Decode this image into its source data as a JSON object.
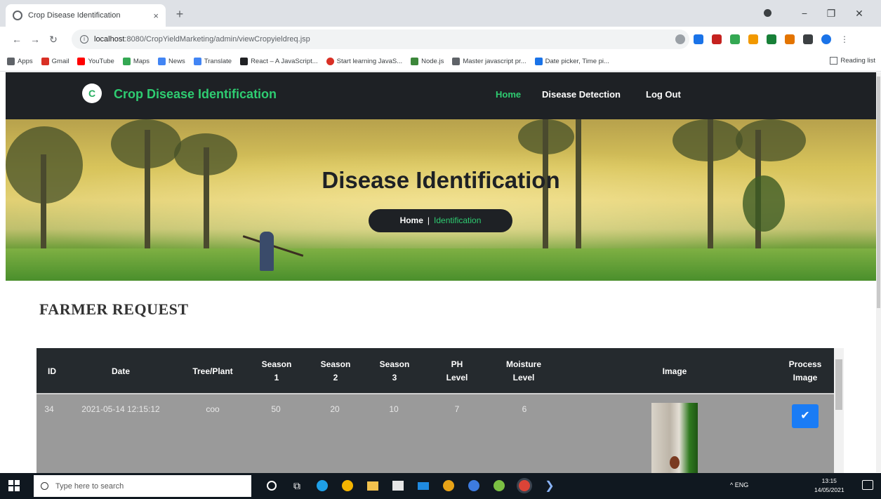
{
  "browser": {
    "tab_title": "Crop Disease Identification",
    "tab_close": "×",
    "new_tab": "+",
    "url_host": "localhost",
    "url_rest": ":8080/CropYieldMarketing/admin/viewCropyieldreq.jsp",
    "win_min": "−",
    "win_max": "❐",
    "win_close": "✕",
    "bookmarks": [
      {
        "label": "Apps",
        "color": "#5f6368"
      },
      {
        "label": "Gmail",
        "color": "#d93025"
      },
      {
        "label": "YouTube",
        "color": "#ff0000"
      },
      {
        "label": "Maps",
        "color": "#34a853"
      },
      {
        "label": "News",
        "color": "#4285f4"
      },
      {
        "label": "Translate",
        "color": "#4285f4"
      },
      {
        "label": "React – A JavaScript...",
        "color": "#202124"
      },
      {
        "label": "Start learning JavaS...",
        "color": "#d93025"
      },
      {
        "label": "Node.js",
        "color": "#3c873a"
      },
      {
        "label": "Master javascript pr...",
        "color": "#5f6368"
      },
      {
        "label": "Date picker, Time pi...",
        "color": "#1a73e8"
      }
    ],
    "reading_list": "Reading list"
  },
  "site": {
    "logo_letter": "C",
    "brand": "Crop Disease Identification",
    "nav": [
      "Home",
      "Disease Detection",
      "Log Out"
    ],
    "accent": "#2ecc71"
  },
  "hero": {
    "title": "Disease Identification",
    "crumb_home": "Home",
    "crumb_sep": "|",
    "crumb_current": "Identification"
  },
  "section_title": "FARMER REQUEST",
  "table": {
    "headers": [
      "ID",
      "Date",
      "Tree/Plant",
      "Season 1",
      "Season 2",
      "Season 3",
      "PH Level",
      "Moisture Level",
      "Image",
      "Process Image"
    ],
    "rows": [
      {
        "id": "34",
        "date": "2021-05-14 12:15:12",
        "plant": "coo",
        "s1": "50",
        "s2": "20",
        "s3": "10",
        "ph": "7",
        "moisture": "6"
      }
    ],
    "process_icon": "check-icon"
  },
  "taskbar": {
    "search_placeholder": "Type here to search",
    "tray_text": "^   ENG",
    "time": "13:15",
    "date": "14/05/2021"
  }
}
